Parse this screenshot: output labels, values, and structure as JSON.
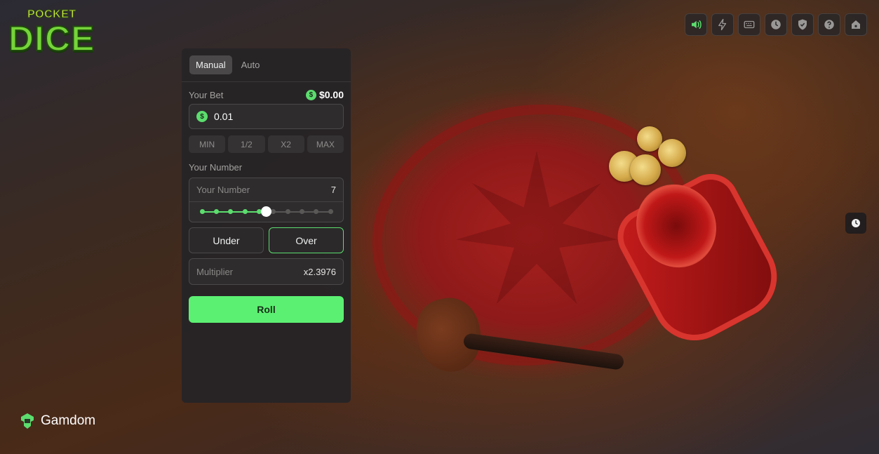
{
  "logo": {
    "line1": "POCKET",
    "line2": "DICE"
  },
  "toolbar": {
    "icons": [
      "sound-icon",
      "lightning-icon",
      "keyboard-icon",
      "history-icon",
      "shield-icon",
      "help-icon",
      "home-icon"
    ],
    "accent_sound": "#5cdd6e"
  },
  "tabs": [
    {
      "label": "Manual",
      "active": true
    },
    {
      "label": "Auto",
      "active": false
    }
  ],
  "bet": {
    "label": "Your Bet",
    "balance": "$0.00",
    "currency_symbol": "$",
    "value": "0.01"
  },
  "quick_buttons": [
    "MIN",
    "1/2",
    "X2",
    "MAX"
  ],
  "number": {
    "label": "Your Number",
    "placeholder": "Your Number",
    "value": "7",
    "slider_fraction": 0.5
  },
  "direction": {
    "under": "Under",
    "over": "Over",
    "selected": "over"
  },
  "multiplier": {
    "placeholder": "Multiplier",
    "value": "x2.3976"
  },
  "roll_label": "Roll",
  "brand": {
    "name": "Gamdom"
  },
  "colors": {
    "accent": "#5cdd6e",
    "roll_button": "#5cf072",
    "panel": "#262426"
  }
}
